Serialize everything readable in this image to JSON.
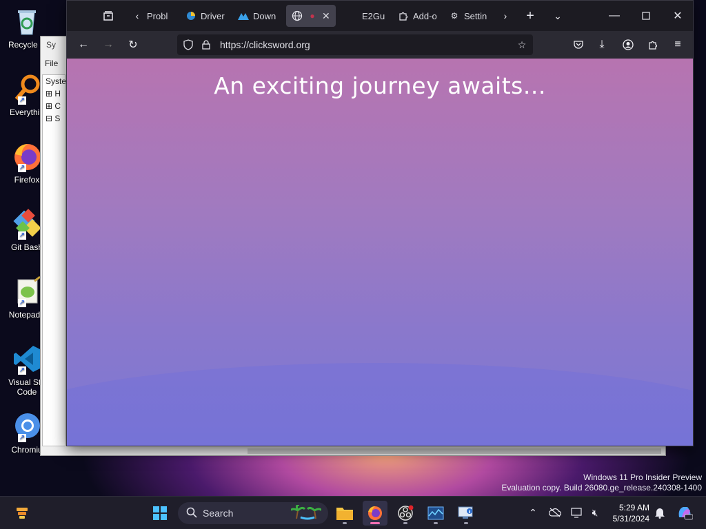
{
  "desktop": {
    "icons": [
      {
        "label": "Recycle Bin",
        "display": "Recycle B"
      },
      {
        "label": "Everything",
        "display": "Everythin"
      },
      {
        "label": "Firefox",
        "display": "Firefox"
      },
      {
        "label": "Git Bash",
        "display": "Git Bash"
      },
      {
        "label": "Notepad++",
        "display": "Notepad+"
      },
      {
        "label": "Visual Studio Code",
        "display": "Visual Stu Code"
      },
      {
        "label": "Chromium",
        "display": "Chromiu"
      }
    ],
    "watermark": {
      "line1": "Windows 11 Pro Insider Preview",
      "line2": "Evaluation copy. Build 26080.ge_release.240308-1400"
    }
  },
  "background_window": {
    "title": "Sy",
    "menu_file": "File",
    "tree": [
      "Syste",
      "H",
      "C",
      "S"
    ]
  },
  "browser": {
    "tabs": [
      {
        "label": "Probl",
        "icon": "problem-icon"
      },
      {
        "label": "Driver",
        "icon": "driver-icon"
      },
      {
        "label": "Down",
        "icon": "download-icon"
      },
      {
        "label": "",
        "icon": "globe-icon",
        "active": true
      },
      {
        "label": "E2Gu",
        "icon": "e2-icon"
      },
      {
        "label": "Add-o",
        "icon": "puzzle-icon"
      },
      {
        "label": "Settin",
        "icon": "gear-icon"
      }
    ],
    "url": "https://clicksword.org",
    "page_heading": "An exciting journey awaits..."
  },
  "taskbar": {
    "search_placeholder": "Search",
    "time": "5:29 AM",
    "date": "5/31/2024"
  },
  "colors": {
    "accent": "#f26fb2",
    "page_gradient_top": "#b774b0",
    "page_gradient_bottom": "#7b77d4"
  }
}
